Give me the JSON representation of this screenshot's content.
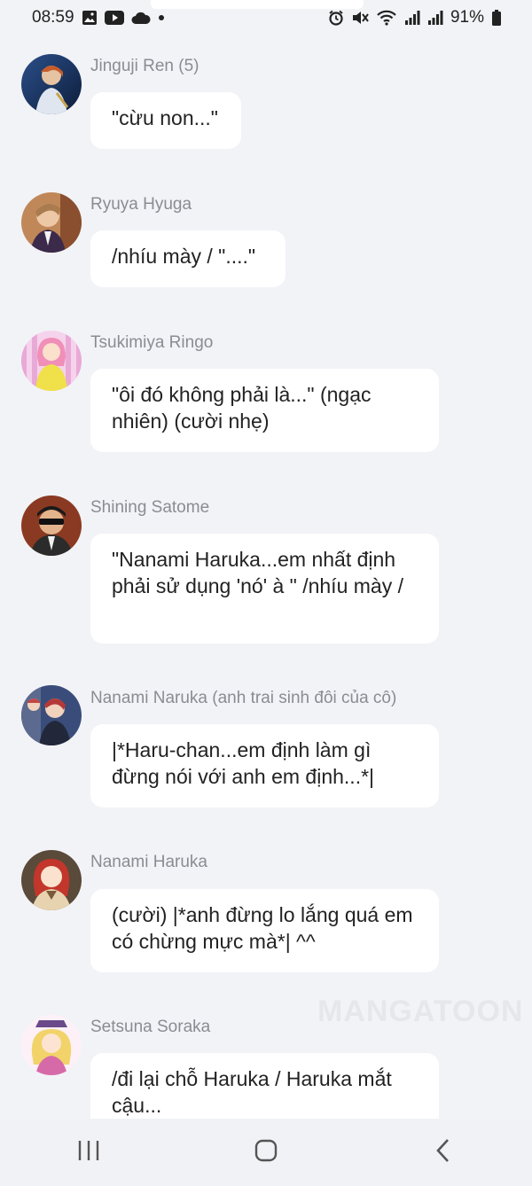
{
  "status_bar": {
    "time": "08:59",
    "battery": "91%",
    "left_icons": [
      "gallery-icon",
      "youtube-icon",
      "cloud-icon",
      "dot-icon"
    ],
    "right_icons": [
      "alarm-icon",
      "mute-icon",
      "wifi-icon",
      "signal-icon",
      "signal-icon",
      "battery-icon"
    ]
  },
  "messages": [
    {
      "name": "Jinguji Ren (5)",
      "text": "\"cừu non...\"",
      "avatar_colors": [
        "#1b3a6b",
        "#c9a24c"
      ]
    },
    {
      "name": "Ryuya Hyuga",
      "text": "/nhíu mày / \"....\"",
      "avatar_colors": [
        "#b7784a",
        "#3c2a4a"
      ]
    },
    {
      "name": "Tsukimiya Ringo",
      "text": "\"ôi đó không phải là...\" (ngạc nhiên) (cười nhẹ)",
      "avatar_colors": [
        "#e9a9d6",
        "#f0e04a"
      ]
    },
    {
      "name": "Shining Satome",
      "text": "\"Nanami Haruka...em nhất định phải sử dụng 'nó' à \" /nhíu mày /",
      "avatar_colors": [
        "#6b2a1c",
        "#2b2b2b"
      ]
    },
    {
      "name": "Nanami Naruka (anh trai sinh đôi của cô)",
      "text": "|*Haru-chan...em định làm gì đừng nói với anh em định...*|",
      "avatar_colors": [
        "#a33a3a",
        "#3a4d7a"
      ]
    },
    {
      "name": "Nanami Haruka",
      "text": "(cười) |*anh đừng lo lắng quá em có chừng mực mà*| ^^",
      "avatar_colors": [
        "#c2362b",
        "#e8d3b0"
      ]
    },
    {
      "name": "Setsuna Soraka",
      "text": "/đi lại chỗ Haruka / Haruka mắt cậu...",
      "avatar_colors": [
        "#f1d36a",
        "#d66aa8"
      ]
    }
  ],
  "watermark": "MANGATOON",
  "nav_bar": {
    "recent_icon": "recent-apps-icon",
    "home_icon": "home-icon",
    "back_icon": "back-icon"
  }
}
